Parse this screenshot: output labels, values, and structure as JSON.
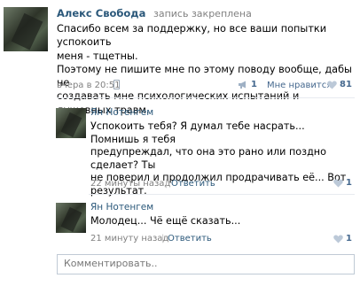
{
  "post": {
    "author": "Алекс Свобода",
    "pinned_label": "запись закреплена",
    "text_lines": [
      "Спасибо всем за поддержку, но все ваши попытки успокоить",
      "меня - тщетны.",
      "Поэтому не пишите мне по этому поводу вообще, дабы не",
      "создавать мне психологических испытаний и душевных травм."
    ],
    "date": "вчера в 20:51",
    "shares": "1",
    "like_label": "Мне нравится",
    "likes": "81"
  },
  "comments": [
    {
      "name": "Ян Нотенгем",
      "text_lines": [
        "Успокоить тебя? Я думал тебе насрать... Помнишь я тебя",
        "предупреждал, что она это рано или поздно сделает? Ты",
        "не поверил и продолжил продрачивать её... Вот",
        "результат."
      ],
      "date": "22 минуты назад",
      "separator": "|",
      "reply_label": "Ответить",
      "likes": "1"
    },
    {
      "name": "Ян Нотенгем",
      "text_lines": [
        "Молодец... Чё ещё сказать..."
      ],
      "date": "21 минуту назад",
      "separator": "|",
      "reply_label": "Ответить",
      "likes": "1"
    }
  ],
  "reply_box": {
    "placeholder": "Комментировать.."
  },
  "icons": {
    "share": "megaphone-icon",
    "like": "heart-icon",
    "device": "mobile-phone-icon"
  },
  "colors": {
    "link": "#2b587a",
    "meta": "#808080",
    "heart": "#bcc9d8"
  }
}
